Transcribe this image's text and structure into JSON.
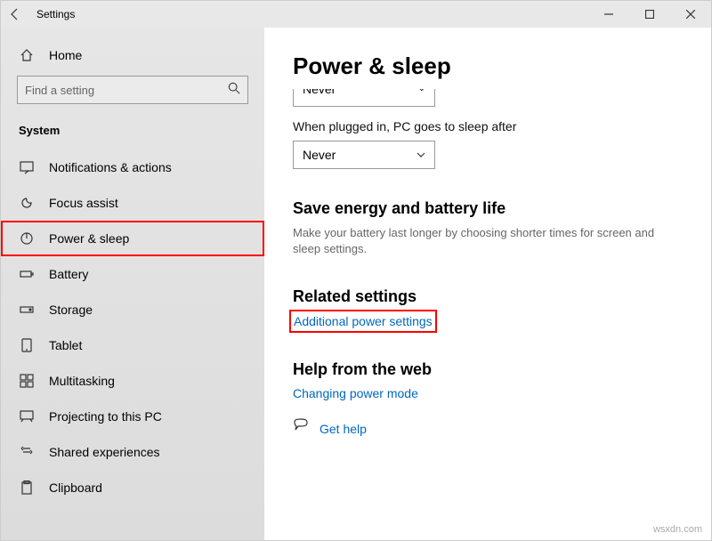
{
  "titlebar": {
    "title": "Settings"
  },
  "sidebar": {
    "home": "Home",
    "search_placeholder": "Find a setting",
    "section": "System",
    "items": [
      {
        "label": "Notifications & actions"
      },
      {
        "label": "Focus assist"
      },
      {
        "label": "Power & sleep"
      },
      {
        "label": "Battery"
      },
      {
        "label": "Storage"
      },
      {
        "label": "Tablet"
      },
      {
        "label": "Multitasking"
      },
      {
        "label": "Projecting to this PC"
      },
      {
        "label": "Shared experiences"
      },
      {
        "label": "Clipboard"
      }
    ]
  },
  "content": {
    "title": "Power & sleep",
    "sleep_dropdown1_value": "Never",
    "sleep_plugged_label": "When plugged in, PC goes to sleep after",
    "sleep_dropdown2_value": "Never",
    "save_energy_h": "Save energy and battery life",
    "save_energy_desc": "Make your battery last longer by choosing shorter times for screen and sleep settings.",
    "related_h": "Related settings",
    "related_link": "Additional power settings",
    "help_h": "Help from the web",
    "help_link": "Changing power mode",
    "gethelp": "Get help"
  },
  "watermark": "wsxdn.com"
}
